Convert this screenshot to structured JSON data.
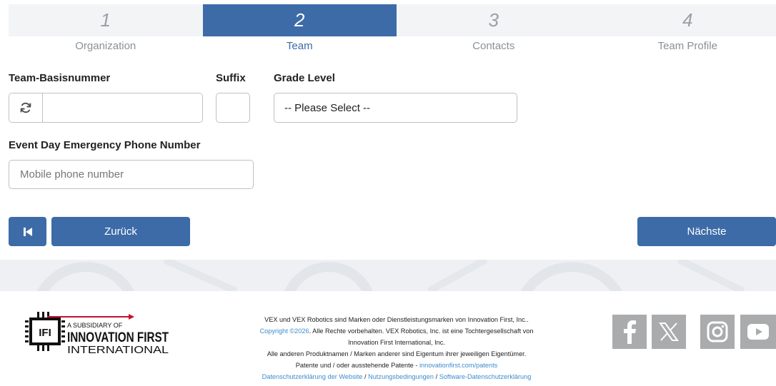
{
  "stepper": [
    {
      "number": "1",
      "label": "Organization",
      "active": false
    },
    {
      "number": "2",
      "label": "Team",
      "active": true
    },
    {
      "number": "3",
      "label": "Contacts",
      "active": false
    },
    {
      "number": "4",
      "label": "Team Profile",
      "active": false
    }
  ],
  "form": {
    "team_base_label": "Team-Basisnummer",
    "team_base_value": "",
    "suffix_label": "Suffix",
    "suffix_value": "",
    "grade_label": "Grade Level",
    "grade_selected": "-- Please Select --",
    "phone_label": "Event Day Emergency Phone Number",
    "phone_placeholder": "Mobile phone number"
  },
  "nav": {
    "back_label": "Zurück",
    "next_label": "Nächste"
  },
  "footer": {
    "logo_top": "A SUBSIDIARY OF",
    "logo_main": "INNOVATION FIRST",
    "logo_sub": "INTERNATIONAL",
    "logo_mark": "IFI",
    "line1": "VEX und VEX Robotics sind Marken oder Dienstleistungsmarken von Innovation First, Inc..",
    "copyright_link": "Copyright ©2026",
    "line2_rest": ". Alle Rechte vorbehalten. VEX Robotics, Inc. ist eine Tochtergesellschaft von",
    "line3": "Innovation First International, Inc.",
    "line4": "Alle anderen Produktnamen / Marken anderer sind Eigentum ihrer jeweiligen Eigentümer.",
    "line5_text": "Patente und / oder ausstehende Patente - ",
    "patents_link": "innovationfirst.com/patents",
    "privacy_link": "Datenschutzerklärung der Website",
    "terms_link": "Nutzungsbedingungen",
    "software_privacy_link": "Software-Datenschutzerklärung",
    "sep": " / "
  },
  "social": [
    "facebook-icon",
    "x-icon",
    "instagram-icon",
    "youtube-icon"
  ],
  "colors": {
    "primary": "#3c6ba8",
    "link": "#3c8ccd",
    "social_bg": "#a9abad",
    "step_bg": "#f3f4f6"
  }
}
